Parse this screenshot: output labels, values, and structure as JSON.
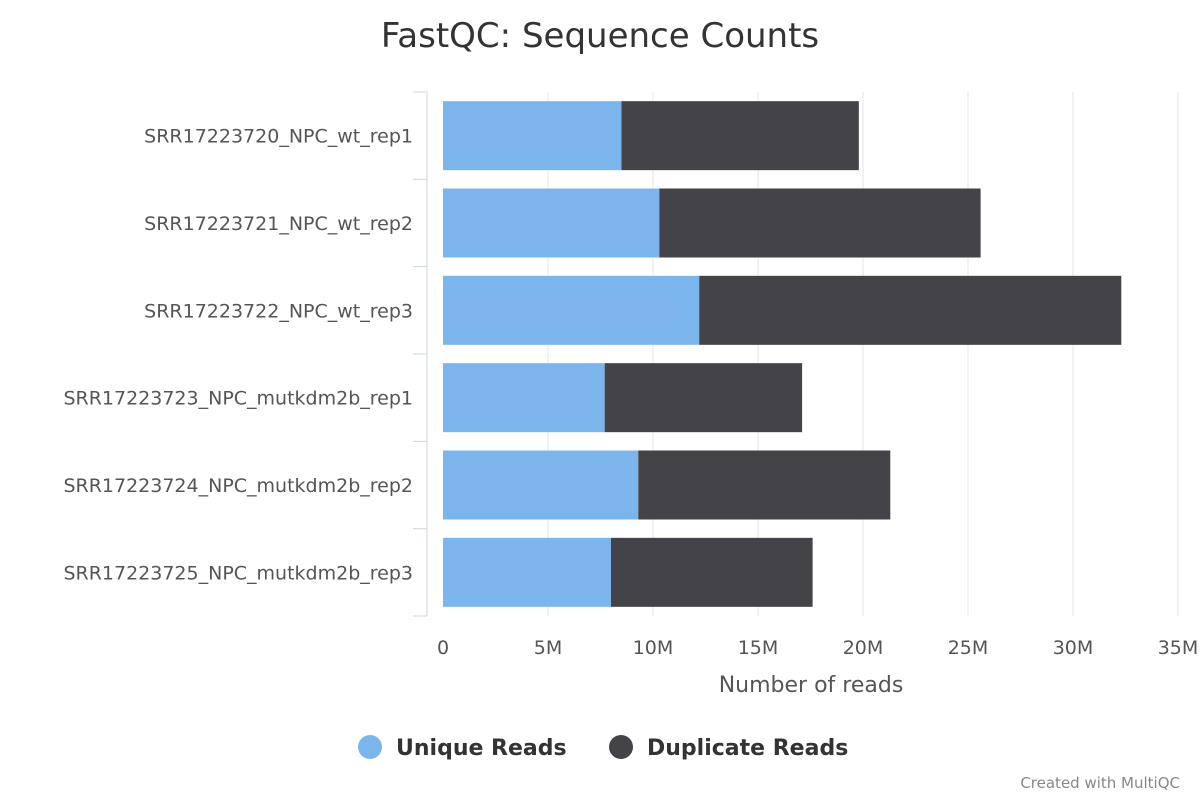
{
  "chart_data": {
    "type": "bar",
    "orientation": "horizontal",
    "stacked": true,
    "title": "FastQC: Sequence Counts",
    "xlabel": "Number of reads",
    "ylabel": "",
    "categories": [
      "SRR17223720_NPC_wt_rep1",
      "SRR17223721_NPC_wt_rep2",
      "SRR17223722_NPC_wt_rep3",
      "SRR17223723_NPC_mutkdm2b_rep1",
      "SRR17223724_NPC_mutkdm2b_rep2",
      "SRR17223725_NPC_mutkdm2b_rep3"
    ],
    "series": [
      {
        "name": "Unique Reads",
        "color": "#7cb5ec",
        "values": [
          8500000,
          10300000,
          12200000,
          7700000,
          9300000,
          8000000
        ]
      },
      {
        "name": "Duplicate Reads",
        "color": "#434348",
        "values": [
          11300000,
          15300000,
          20100000,
          9400000,
          12000000,
          9600000
        ]
      }
    ],
    "xlim": [
      0,
      35000000
    ],
    "xticks": [
      0,
      5000000,
      10000000,
      15000000,
      20000000,
      25000000,
      30000000,
      35000000
    ],
    "xtick_labels": [
      "0",
      "5M",
      "10M",
      "15M",
      "20M",
      "25M",
      "30M",
      "35M"
    ],
    "grid": true,
    "legend_position": "bottom"
  },
  "credit": "Created with MultiQC"
}
